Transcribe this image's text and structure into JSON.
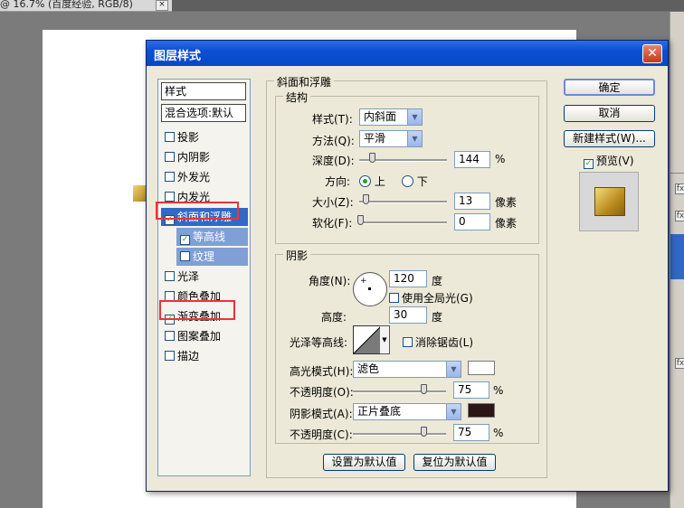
{
  "workspace": {
    "doc_tab_text": "@ 16.7% (百度经验, RGB/8)",
    "doc_tab_close": "×",
    "right_panel_icons": [
      "fx",
      "fx",
      "fx"
    ]
  },
  "dialog": {
    "title": "图层样式",
    "close_glyph": "✕"
  },
  "style_list": {
    "header": "样式",
    "blend_options": "混合选项:默认",
    "items": [
      {
        "label": "投影",
        "checked": false
      },
      {
        "label": "内阴影",
        "checked": false
      },
      {
        "label": "外发光",
        "checked": false
      },
      {
        "label": "内发光",
        "checked": false
      },
      {
        "label": "斜面和浮雕",
        "checked": true,
        "selected": true
      },
      {
        "label": "等高线",
        "checked": true,
        "sub": true
      },
      {
        "label": "纹理",
        "checked": false,
        "sub": true
      },
      {
        "label": "光泽",
        "checked": false
      },
      {
        "label": "颜色叠加",
        "checked": false
      },
      {
        "label": "渐变叠加",
        "checked": true
      },
      {
        "label": "图案叠加",
        "checked": false
      },
      {
        "label": "描边",
        "checked": false
      }
    ],
    "check_glyph": "✓"
  },
  "bevel": {
    "group_title": "斜面和浮雕",
    "structure": {
      "title": "结构",
      "style_label": "样式(T):",
      "style_value": "内斜面",
      "technique_label": "方法(Q):",
      "technique_value": "平滑",
      "depth_label": "深度(D):",
      "depth_value": "144",
      "depth_unit": "%",
      "depth_slider_fraction": 0.144,
      "direction_label": "方向:",
      "direction_up": "上",
      "direction_down": "下",
      "direction_selected": "上",
      "size_label": "大小(Z):",
      "size_value": "13",
      "size_unit": "像素",
      "soften_label": "软化(F):",
      "soften_value": "0",
      "soften_unit": "像素"
    },
    "shading": {
      "title": "阴影",
      "angle_label": "角度(N):",
      "angle_value": "120",
      "angle_unit": "度",
      "global_light_label": "使用全局光(G)",
      "global_light_checked": false,
      "altitude_label": "高度:",
      "altitude_value": "30",
      "altitude_unit": "度",
      "gloss_contour_label": "光泽等高线:",
      "anti_alias_label": "消除锯齿(L)",
      "anti_alias_checked": false,
      "highlight_mode_label": "高光模式(H):",
      "highlight_mode_value": "滤色",
      "highlight_color": "#ffffff",
      "highlight_opacity_label": "不透明度(O):",
      "highlight_opacity_value": "75",
      "highlight_opacity_unit": "%",
      "shadow_mode_label": "阴影模式(A):",
      "shadow_mode_value": "正片叠底",
      "shadow_color": "#2a1616",
      "shadow_opacity_label": "不透明度(C):",
      "shadow_opacity_value": "75",
      "shadow_opacity_unit": "%"
    },
    "make_default": "设置为默认值",
    "reset_default": "复位为默认值"
  },
  "buttons": {
    "ok": "确定",
    "cancel": "取消",
    "new_style": "新建样式(W)...",
    "preview_label": "预览(V)",
    "preview_checked": true
  },
  "colors": {
    "titlebar": "#0b4fd4",
    "selection": "#316ac5",
    "highlight_box": "#e33333"
  }
}
